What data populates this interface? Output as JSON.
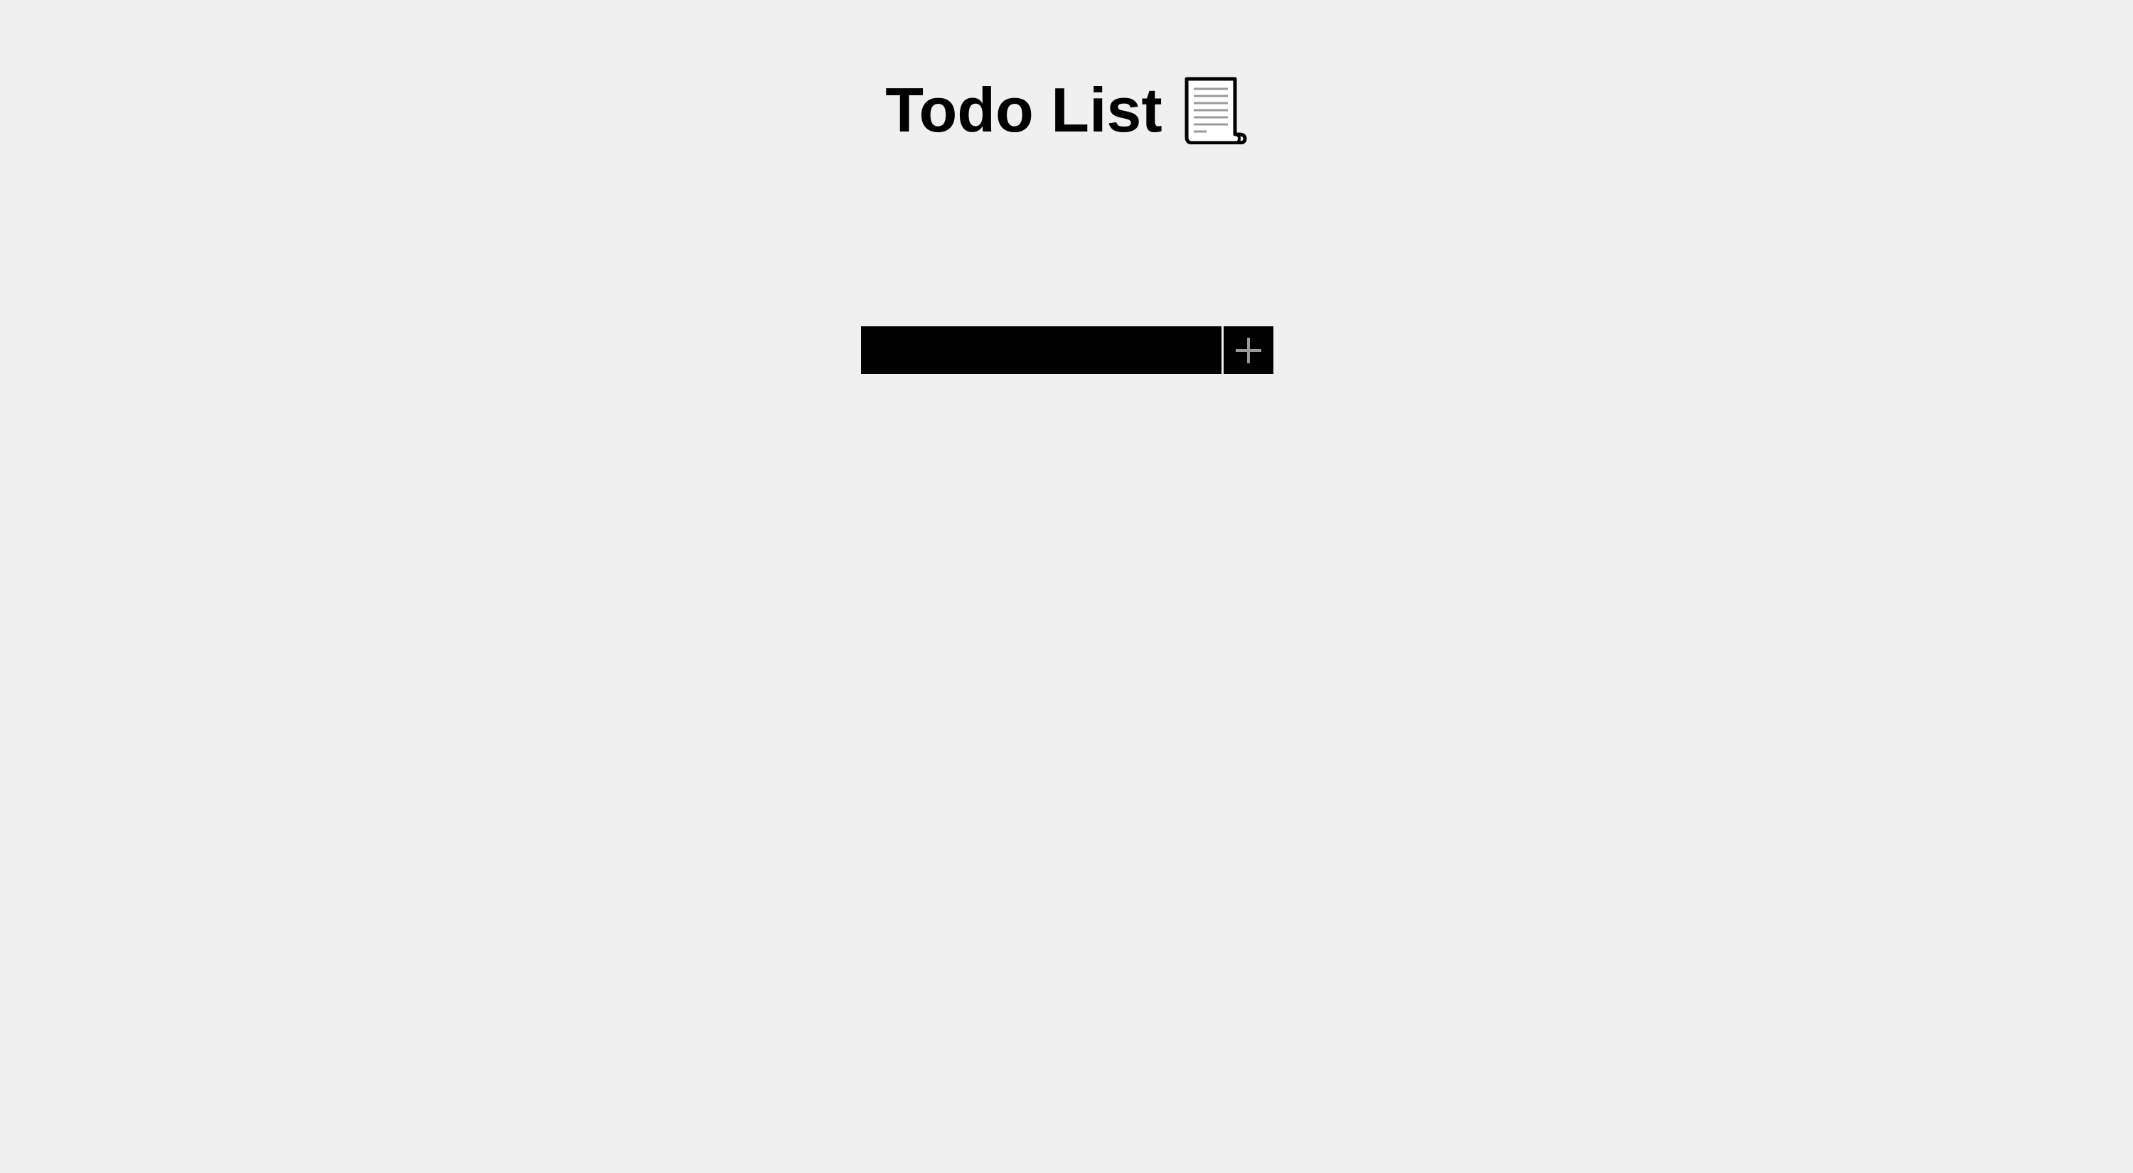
{
  "header": {
    "title": "Todo List",
    "title_icon": "scroll-page-icon"
  },
  "form": {
    "input_value": "",
    "input_placeholder": "",
    "add_button_icon": "plus-icon"
  },
  "colors": {
    "background": "#f0f0f0",
    "input_background": "#000000",
    "button_background": "#000000",
    "plus_icon": "#9a9a9a",
    "title_text": "#000000"
  }
}
